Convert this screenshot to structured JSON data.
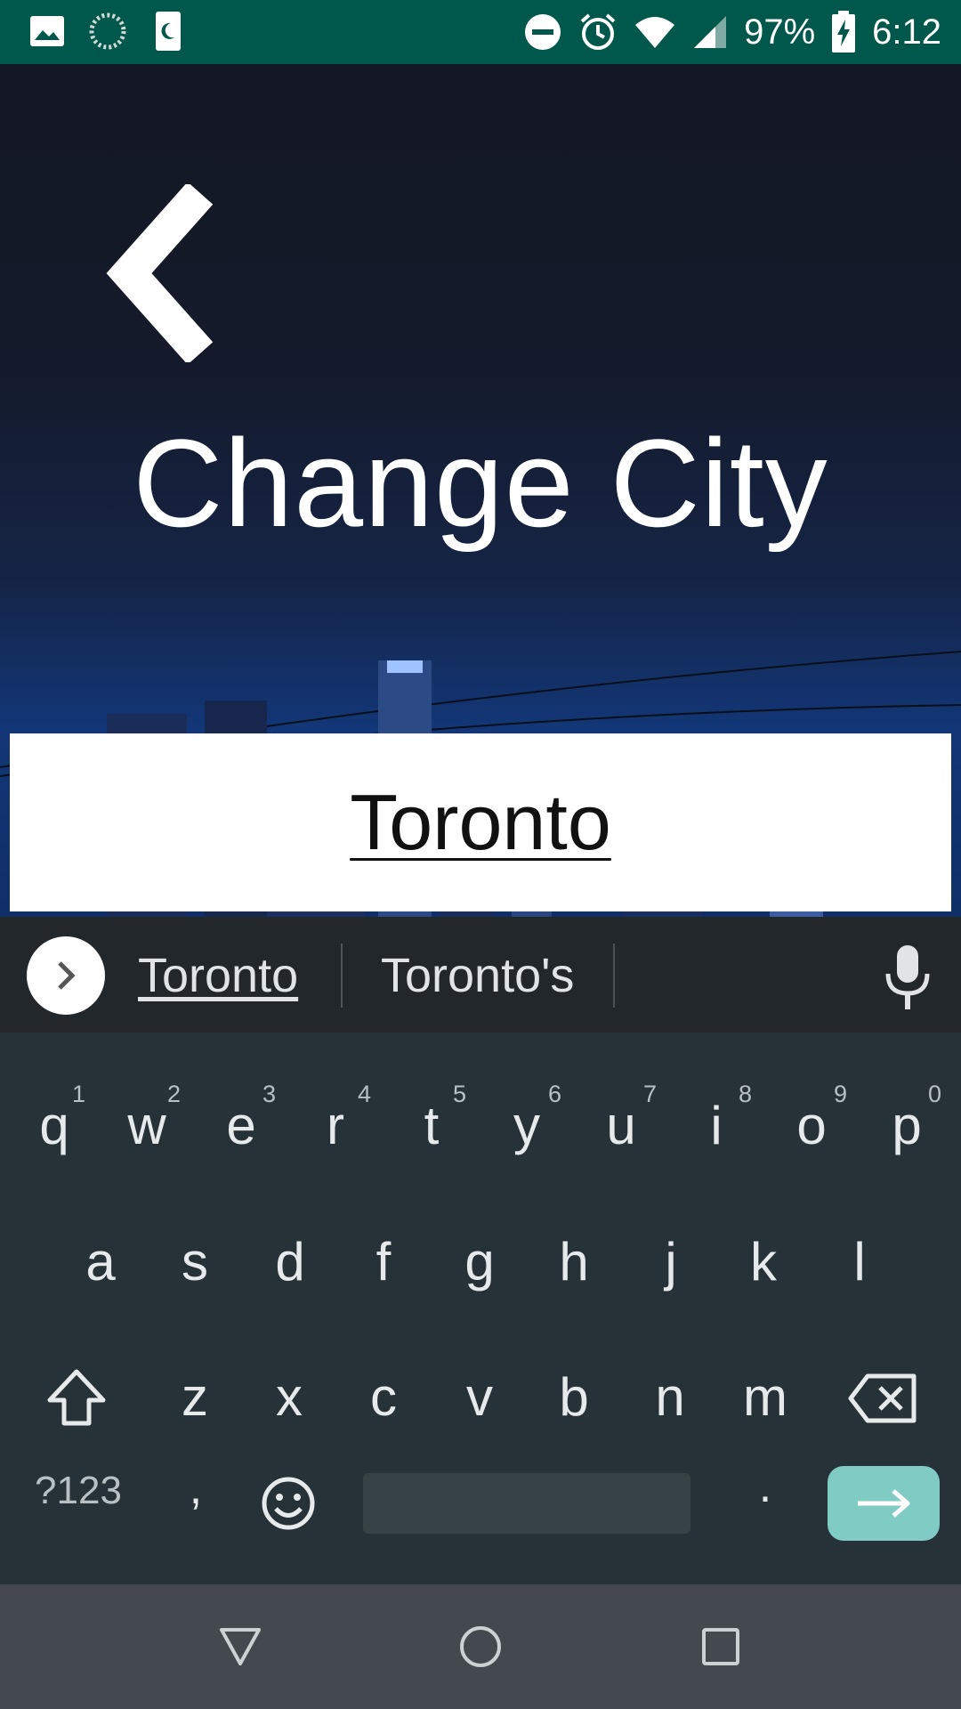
{
  "status_bar": {
    "battery": "97%",
    "time": "6:12",
    "icons": [
      "image-icon",
      "loading-icon",
      "moon-icon",
      "do-not-disturb-icon",
      "alarm-icon",
      "wifi-icon",
      "signal-icon",
      "battery-charging-icon"
    ],
    "background": "#00574B"
  },
  "header": {
    "back_icon": "chevron-left-icon",
    "title": "Change City"
  },
  "city_input": {
    "value": "Toronto"
  },
  "keyboard": {
    "suggestions": [
      "Toronto",
      "Toronto's"
    ],
    "row1": [
      {
        "k": "q",
        "h": "1"
      },
      {
        "k": "w",
        "h": "2"
      },
      {
        "k": "e",
        "h": "3"
      },
      {
        "k": "r",
        "h": "4"
      },
      {
        "k": "t",
        "h": "5"
      },
      {
        "k": "y",
        "h": "6"
      },
      {
        "k": "u",
        "h": "7"
      },
      {
        "k": "i",
        "h": "8"
      },
      {
        "k": "o",
        "h": "9"
      },
      {
        "k": "p",
        "h": "0"
      }
    ],
    "row2": [
      "a",
      "s",
      "d",
      "f",
      "g",
      "h",
      "j",
      "k",
      "l"
    ],
    "row3": [
      "z",
      "x",
      "c",
      "v",
      "b",
      "n",
      "m"
    ],
    "symbols_label": "?123",
    "comma": ",",
    "period": ".",
    "accent": "#80CBC4"
  },
  "nav_bar": {
    "buttons": [
      "back-triangle-icon",
      "home-circle-icon",
      "recents-square-icon"
    ]
  }
}
